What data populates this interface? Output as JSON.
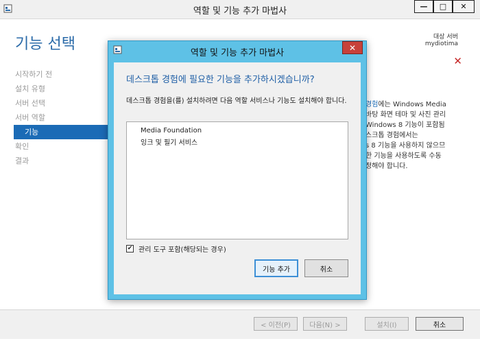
{
  "window": {
    "title": "역할 및 기능 추가 마법사",
    "minimize_glyph": "—",
    "maximize_glyph": "□",
    "close_glyph": "✕"
  },
  "header": {
    "page_title": "기능 선택",
    "dest_label": "대상 서버",
    "dest_server": "mydiotima",
    "close_glyph": "✕"
  },
  "steps": [
    {
      "label": "시작하기 전"
    },
    {
      "label": "설치 유형"
    },
    {
      "label": "서버 선택"
    },
    {
      "label": "서버 역할"
    },
    {
      "label": "기능",
      "active": true
    },
    {
      "label": "확인"
    },
    {
      "label": "결과"
    }
  ],
  "description": {
    "link": "경험",
    "lines": [
      "에는 Windows Media",
      "바탕 화면 테마 및 사진 관리",
      "Windows 8 기능이 포함됨",
      "스크톱 경험에서는",
      "s 8 기능을 사용하지 않으므",
      "한 기능을 사용하도록 수동",
      "정해야 합니다."
    ]
  },
  "footer": {
    "prev_label": "< 이전(P)",
    "next_label": "다음(N) >",
    "install_label": "설치(I)",
    "cancel_label": "취소"
  },
  "dialog": {
    "title": "역할 및 기능 추가 마법사",
    "close_glyph": "✕",
    "question": "데스크톱 경험에 필요한 기능을 추가하시겠습니까?",
    "desc": "데스크톱 경험을(를) 설치하려면 다음 역할 서비스나 기능도 설치해야 합니다.",
    "features": [
      "Media Foundation",
      "잉크 및 필기 서비스"
    ],
    "checkbox_label": "관리 도구 포함(해당되는 경우)",
    "checkbox_checked": true,
    "add_label": "기능 추가",
    "cancel_label": "취소"
  },
  "colors": {
    "accent": "#1b6bb6",
    "dialog_frame": "#5ec1e6",
    "close_red": "#c7413a"
  }
}
